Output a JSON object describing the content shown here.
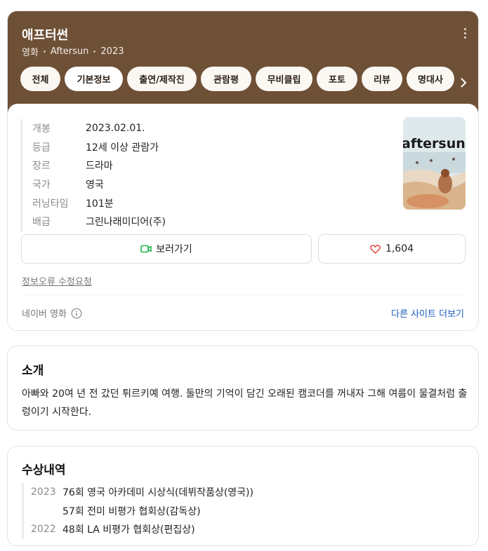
{
  "movie": {
    "title": "애프터썬",
    "meta": [
      "영화",
      "Aftersun",
      "2023"
    ]
  },
  "tabs": [
    {
      "label": "전체",
      "active": false
    },
    {
      "label": "기본정보",
      "active": true
    },
    {
      "label": "출연/제작진",
      "active": false
    },
    {
      "label": "관람평",
      "active": false
    },
    {
      "label": "무비클립",
      "active": false
    },
    {
      "label": "포토",
      "active": false
    },
    {
      "label": "리뷰",
      "active": false
    },
    {
      "label": "명대사",
      "active": false
    }
  ],
  "info": [
    {
      "key": "개봉",
      "value": "2023.02.01."
    },
    {
      "key": "등급",
      "value": "12세 이상 관람가"
    },
    {
      "key": "장르",
      "value": "드라마"
    },
    {
      "key": "국가",
      "value": "영국"
    },
    {
      "key": "러닝타임",
      "value": "101분"
    },
    {
      "key": "배급",
      "value": "그린나래미디어(주)"
    }
  ],
  "poster": {
    "title_text": "aftersun"
  },
  "actions": {
    "watch_label": "보러가기",
    "like_count": "1,604"
  },
  "links": {
    "report_error": "정보오류 수정요청",
    "source": "네이버 영화",
    "more_sites": "다른 사이트 더보기"
  },
  "intro": {
    "heading": "소개",
    "text": "아빠와 20여 년 전 갔던 튀르키예 여행. 둘만의 기억이 담긴 오래된 캠코더를 꺼내자 그해 여름이 물결처럼 출렁이기 시작한다."
  },
  "awards": {
    "heading": "수상내역",
    "items": [
      {
        "year": "2023",
        "text": "76회 영국 아카데미 시상식(데뷔작품상(영국))"
      },
      {
        "year": "",
        "text": "57회 전미 비평가 협회상(감독상)"
      },
      {
        "year": "2022",
        "text": "48회 LA 비평가 협회상(편집상)"
      }
    ]
  },
  "colors": {
    "header_bg": "#6e5036",
    "link_blue": "#1a5dbf",
    "heart_red": "#e2453c",
    "video_green": "#21b34a"
  }
}
